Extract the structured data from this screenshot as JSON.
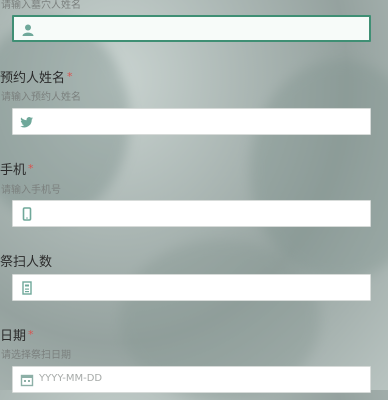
{
  "fields": [
    {
      "label": "",
      "hint": "请输入墓穴人姓名",
      "icon": "user-icon",
      "focused": true,
      "placeholder": ""
    },
    {
      "label": "预约人姓名",
      "required": "*",
      "hint": "请输入预约人姓名",
      "icon": "bird-icon",
      "placeholder": ""
    },
    {
      "label": "手机",
      "required": "*",
      "hint": "请输入手机号",
      "icon": "phone-icon",
      "placeholder": ""
    },
    {
      "label": "祭扫人数",
      "required": "",
      "hint": "",
      "icon": "count-icon",
      "placeholder": ""
    },
    {
      "label": "日期",
      "required": "*",
      "hint": "请选择祭扫日期",
      "icon": "calendar-icon",
      "placeholder": "YYYY-MM-DD"
    }
  ],
  "colors": {
    "accent": "#3f8f74",
    "required": "#d9534f",
    "icon": "#6fa89a"
  }
}
